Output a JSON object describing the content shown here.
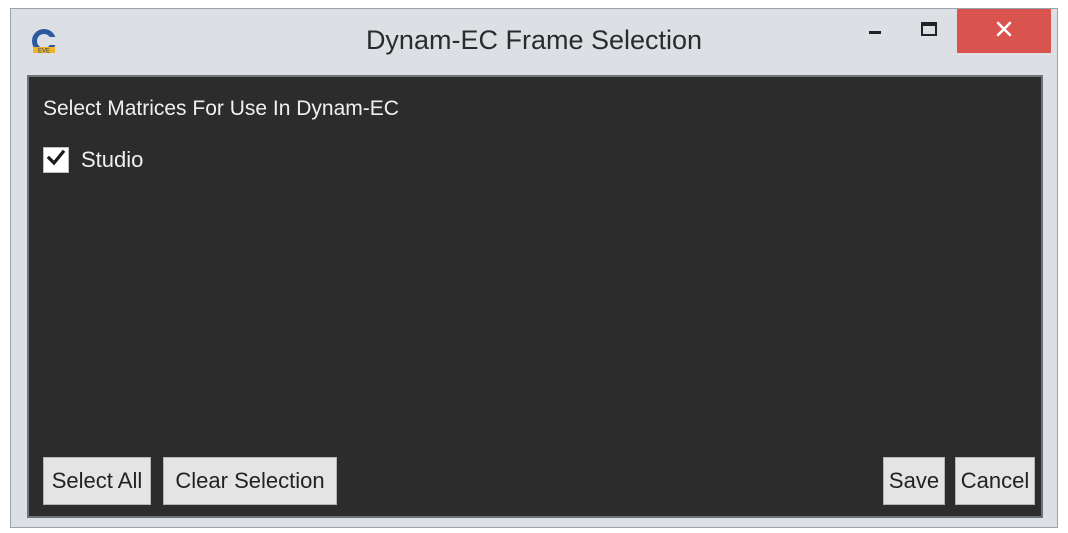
{
  "window": {
    "title": "Dynam-EC Frame Selection",
    "app_icon": "dynam-ec-logo-icon",
    "controls": {
      "minimize": "minimize-icon",
      "maximize": "maximize-icon",
      "close": "close-icon"
    },
    "close_color": "#d9534f"
  },
  "content": {
    "heading": "Select Matrices For Use In Dynam-EC",
    "matrices": [
      {
        "label": "Studio",
        "checked": true
      }
    ]
  },
  "buttons": {
    "select_all": "Select All",
    "clear_selection": "Clear Selection",
    "save": "Save",
    "cancel": "Cancel"
  },
  "colors": {
    "panel_background": "#2c2c2c",
    "chrome_background": "#dcdfe3"
  }
}
